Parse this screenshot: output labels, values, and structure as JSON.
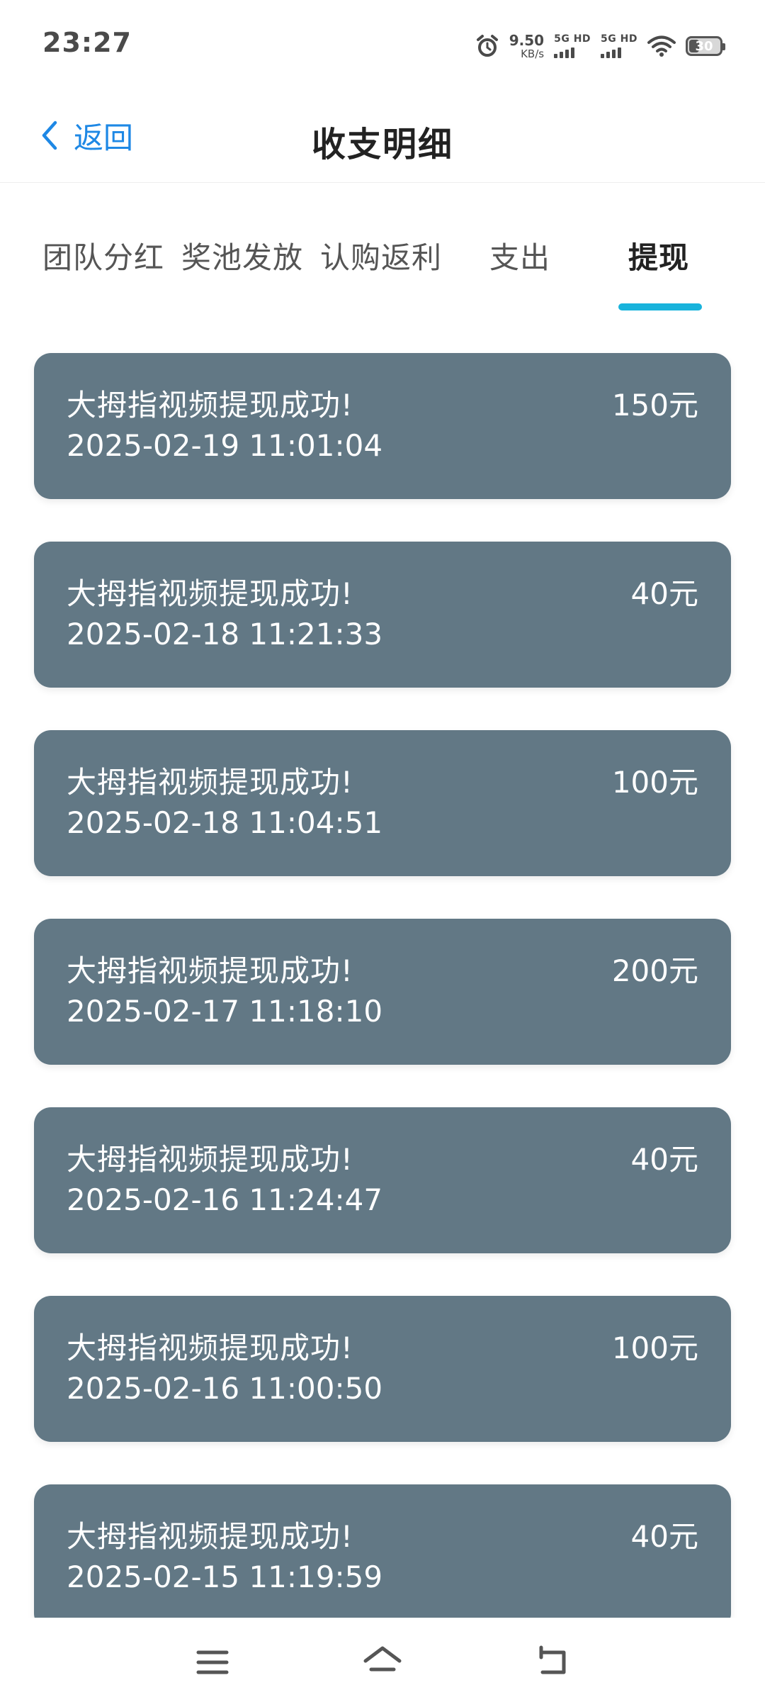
{
  "status_bar": {
    "time": "23:27",
    "net_speed_value": "9.50",
    "net_speed_unit": "KB/s",
    "sim1_label": "5G HD",
    "sim2_label": "5G HD",
    "battery_percent": "30",
    "icons": [
      "alarm-icon",
      "signal-bars-icon",
      "wifi-icon",
      "battery-icon"
    ]
  },
  "header": {
    "back_label": "返回",
    "title": "收支明细"
  },
  "tabs": [
    {
      "label": "团队分红",
      "active": false
    },
    {
      "label": "奖池发放",
      "active": false
    },
    {
      "label": "认购返利",
      "active": false
    },
    {
      "label": "支出",
      "active": false
    },
    {
      "label": "提现",
      "active": true
    }
  ],
  "records": [
    {
      "title": "大拇指视频提现成功!",
      "time": "2025-02-19 11:01:04",
      "amount": "150元"
    },
    {
      "title": "大拇指视频提现成功!",
      "time": "2025-02-18 11:21:33",
      "amount": "40元"
    },
    {
      "title": "大拇指视频提现成功!",
      "time": "2025-02-18 11:04:51",
      "amount": "100元"
    },
    {
      "title": "大拇指视频提现成功!",
      "time": "2025-02-17 11:18:10",
      "amount": "200元"
    },
    {
      "title": "大拇指视频提现成功!",
      "time": "2025-02-16 11:24:47",
      "amount": "40元"
    },
    {
      "title": "大拇指视频提现成功!",
      "time": "2025-02-16 11:00:50",
      "amount": "100元"
    },
    {
      "title": "大拇指视频提现成功!",
      "time": "2025-02-15 11:19:59",
      "amount": "40元"
    }
  ],
  "colors": {
    "accent": "#1e88e5",
    "tab_indicator": "#18b3dc",
    "card_background": "#627885"
  },
  "bottom_nav": {
    "icons": [
      "menu-icon",
      "home-icon",
      "back-icon"
    ]
  }
}
